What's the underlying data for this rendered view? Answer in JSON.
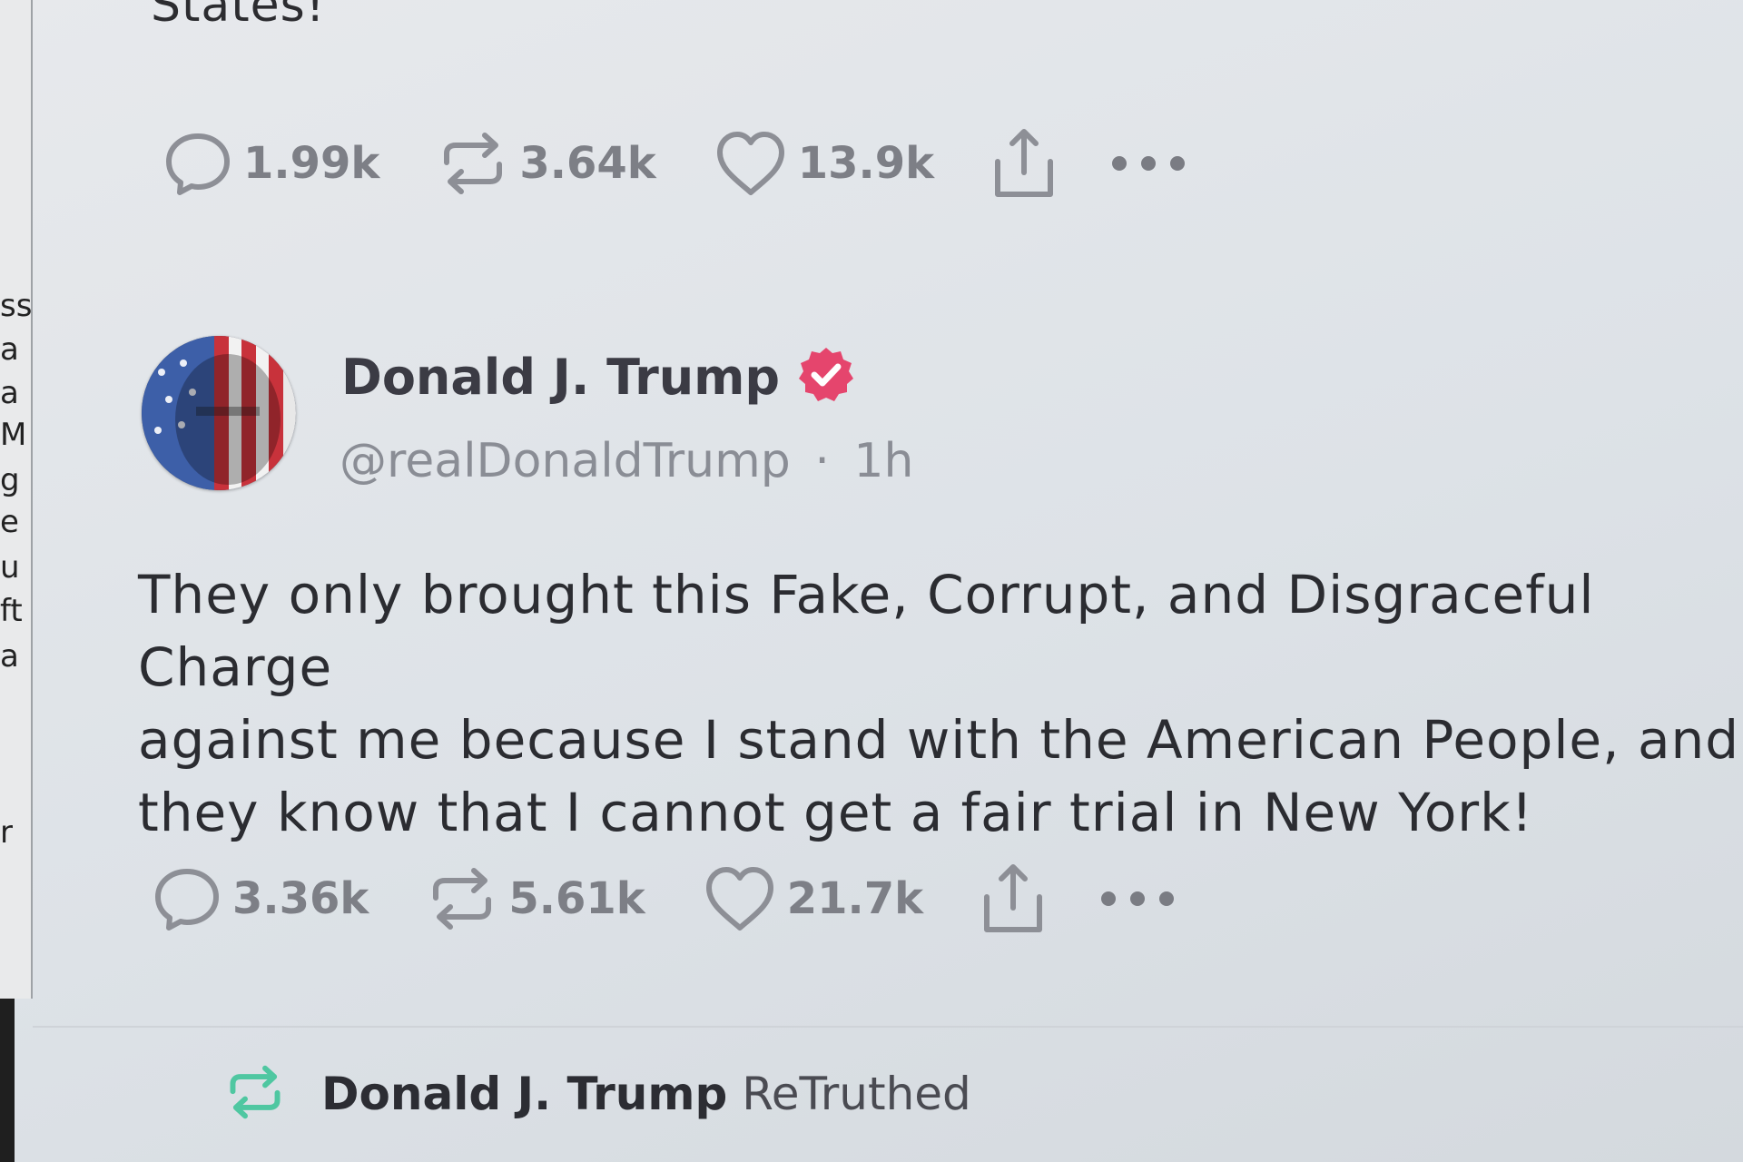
{
  "side_window": {
    "fragments": [
      "ss",
      "a",
      "a",
      "M",
      "g",
      "e",
      "u",
      "ft",
      "a",
      "r"
    ]
  },
  "previous_post": {
    "text_tail": "States!",
    "actions": {
      "replies": "1.99k",
      "retruths": "3.64k",
      "likes": "13.9k"
    }
  },
  "post": {
    "author_name": "Donald J. Trump",
    "handle": "@realDonaldTrump",
    "separator": "·",
    "time": "1h",
    "body": "They only brought this Fake, Corrupt, and Disgraceful Charge\nagainst me because I stand with the American People, and\nthey know that I cannot get a fair trial in New York!",
    "actions": {
      "replies": "3.36k",
      "retruths": "5.61k",
      "likes": "21.7k"
    }
  },
  "retruth_banner": {
    "name": "Donald J. Trump",
    "label": "ReTruthed"
  },
  "icons": {
    "reply": "speech-bubble-icon",
    "retruth": "retruth-arrows-icon",
    "like": "heart-icon",
    "share": "share-upload-icon",
    "more": "more-dots-icon",
    "verified": "verified-badge-icon"
  },
  "colors": {
    "verified_badge": "#e5456d",
    "retruth_green": "#4fc7a1",
    "icon_gray": "#8d8f96",
    "background": "#e3e6ea"
  }
}
